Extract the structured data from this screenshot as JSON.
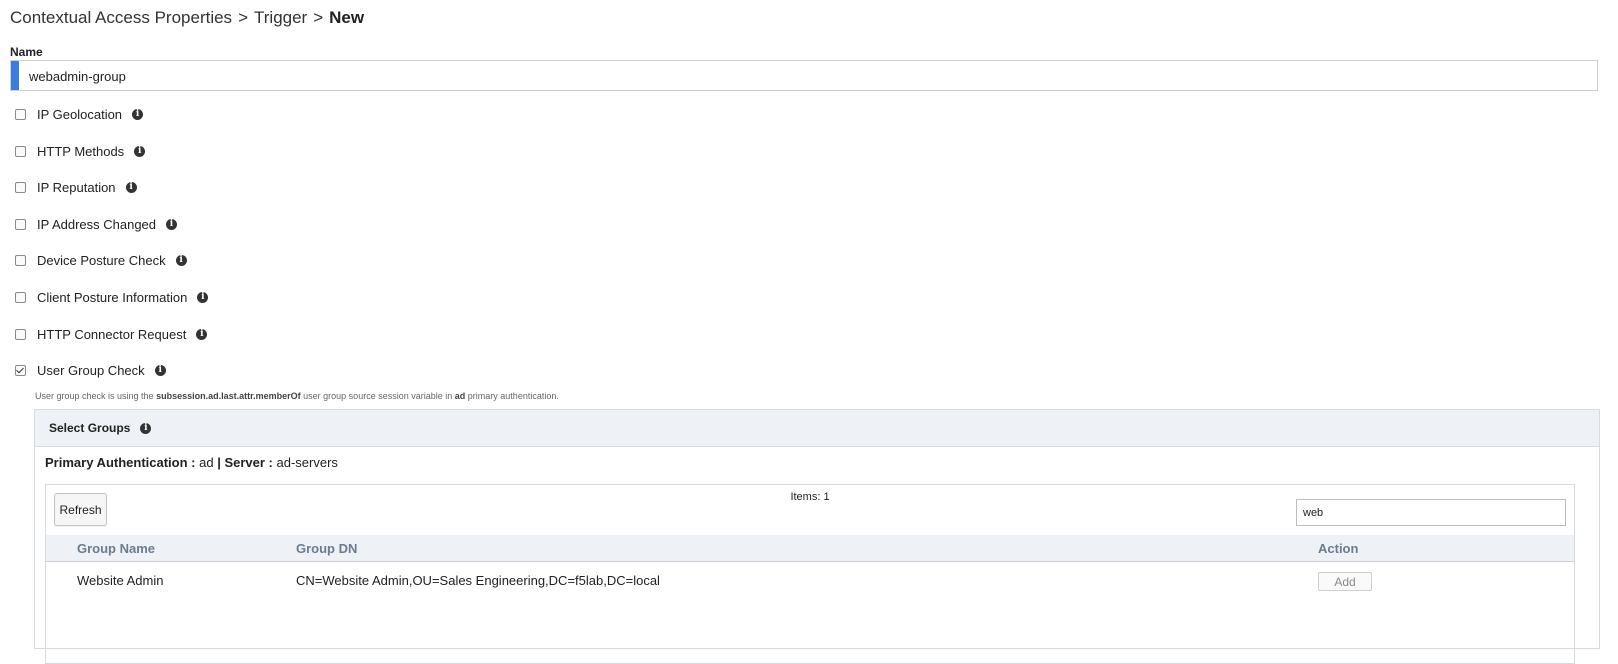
{
  "breadcrumb": {
    "part1": "Contextual Access Properties",
    "sep": ">",
    "part2": "Trigger",
    "current": "New"
  },
  "name_field": {
    "label": "Name",
    "value": "webadmin-group"
  },
  "options": [
    {
      "label": "IP Geolocation",
      "checked": false
    },
    {
      "label": "HTTP Methods",
      "checked": false
    },
    {
      "label": "IP Reputation",
      "checked": false
    },
    {
      "label": "IP Address Changed",
      "checked": false
    },
    {
      "label": "Device Posture Check",
      "checked": false
    },
    {
      "label": "Client Posture Information",
      "checked": false
    },
    {
      "label": "HTTP Connector Request",
      "checked": false
    },
    {
      "label": "User Group Check",
      "checked": true
    }
  ],
  "info_glyph": "i",
  "note": {
    "pre": "User group check is using the",
    "variable": "subsession.ad.last.attr.memberOf",
    "mid": "user group source session variable in",
    "source": "ad",
    "post": "primary authentication."
  },
  "select_groups": {
    "title": "Select Groups",
    "primary_auth_label": "Primary Authentication :",
    "primary_auth_value": "ad",
    "separator": "|",
    "server_label": "Server :",
    "server_value": "ad-servers",
    "items_text": "Items: 1",
    "refresh_label": "Refresh",
    "search_value": "web",
    "columns": {
      "name": "Group Name",
      "dn": "Group DN",
      "action": "Action"
    },
    "rows": [
      {
        "name": "Website Admin",
        "dn": "CN=Website Admin,OU=Sales Engineering,DC=f5lab,DC=local",
        "action": "Add"
      }
    ]
  }
}
